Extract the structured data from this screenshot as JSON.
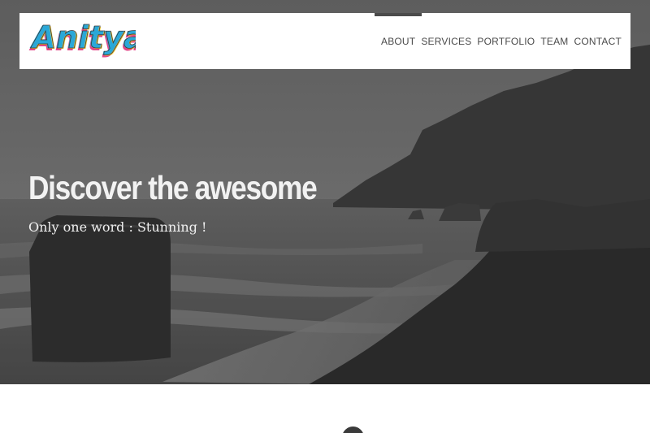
{
  "header": {
    "logo_text": "Anitya",
    "nav": [
      {
        "label": "ABOUT",
        "active": true
      },
      {
        "label": "SERVICES",
        "active": false
      },
      {
        "label": "PORTFOLIO",
        "active": false
      },
      {
        "label": "TEAM",
        "active": false
      },
      {
        "label": "CONTACT",
        "active": false
      }
    ]
  },
  "hero": {
    "title": "Discover the awesome",
    "subtitle": "Only one word : Stunning !"
  },
  "colors": {
    "logo_blue": "#2aa8d8",
    "logo_pink": "#e0337b",
    "logo_yellow": "#f2c21b",
    "logo_dark": "#3a3a3a",
    "nav_text": "#4a4a4a",
    "active_indicator": "#4b4b4b"
  }
}
